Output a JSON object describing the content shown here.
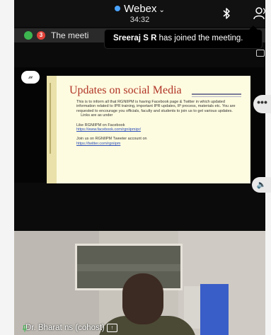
{
  "header": {
    "app_name": "Webex",
    "timer": "34:32"
  },
  "banner": {
    "unread_count": "3",
    "meeting_text": "The meeti"
  },
  "toast": {
    "participant": "Sreeraj S R",
    "message": " has joined the meeting."
  },
  "slide": {
    "presenter_badge": "𝓃",
    "title": "Updates on social Media",
    "body": "This is to inform all that RGNIIPM is having Facebook page & Twitter in which updated information related to IPR training, important IPR updates, IP process, materials etc. You are requested to encourage you officials, faculty and students to join us to get various updates.",
    "links_note": "Links are as under",
    "fb_label": "Like RGNIIPM on Facebook",
    "fb_link": "https://www.facebook.com/rgniipmipr/",
    "tw_label": "Join us on RGNIIPM Tweeter account on",
    "tw_link": "https://twitter.com/rgniipm"
  },
  "side_controls": {
    "more_label": "•••"
  },
  "video": {
    "participant_name": "Dr. Bharat ns (cohost)"
  },
  "colors": {
    "accent": "#4aa3ff",
    "slide_title": "#b03326",
    "slide_bg": "#fefce0",
    "unread_badge": "#e2433a",
    "online": "#3db650"
  }
}
